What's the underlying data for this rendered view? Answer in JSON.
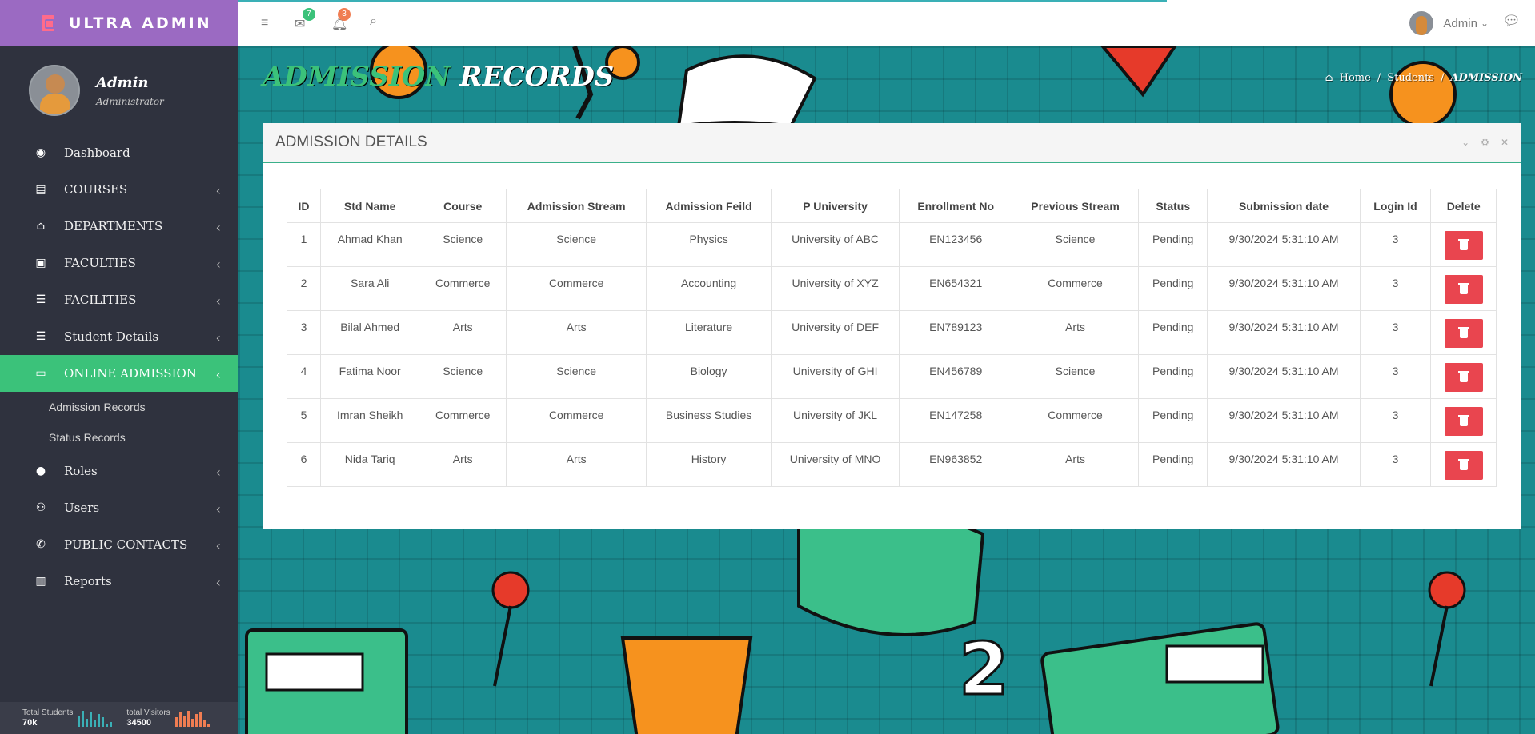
{
  "brand": {
    "title": "ULTRA ADMIN"
  },
  "profile": {
    "name": "Admin",
    "role": "Administrator"
  },
  "sidebar": {
    "items": [
      {
        "label": "Dashboard",
        "icon": "dashboard-icon",
        "has_submenu": false
      },
      {
        "label": "COURSES",
        "icon": "book-icon",
        "has_submenu": true
      },
      {
        "label": "DEPARTMENTS",
        "icon": "bank-icon",
        "has_submenu": true
      },
      {
        "label": "FACULTIES",
        "icon": "chalkboard-teacher-icon",
        "has_submenu": true
      },
      {
        "label": "FACILITIES",
        "icon": "list-icon",
        "has_submenu": true
      },
      {
        "label": "Student Details",
        "icon": "list-icon",
        "has_submenu": true
      },
      {
        "label": "ONLINE ADMISSION",
        "icon": "id-card-icon",
        "has_submenu": true,
        "active": true
      },
      {
        "label": "Roles",
        "icon": "user-circle-icon",
        "has_submenu": true
      },
      {
        "label": "Users",
        "icon": "users-icon",
        "has_submenu": true
      },
      {
        "label": "PUBLIC CONTACTS",
        "icon": "phone-icon",
        "has_submenu": true
      },
      {
        "label": "Reports",
        "icon": "bar-chart-icon",
        "has_submenu": true
      }
    ],
    "submenu": [
      "Admission Records",
      "Status Records"
    ]
  },
  "footer_stats": {
    "students_label": "Total Students",
    "students_value": "70k",
    "visitors_label": "total Visitors",
    "visitors_value": "34500"
  },
  "topbar": {
    "mail_badge": "7",
    "bell_badge": "3",
    "user_name": "Admin"
  },
  "page": {
    "title_part1": "ADMISSION",
    "title_part2": "RECORDS"
  },
  "breadcrumb": {
    "home": "Home",
    "students": "Students",
    "current": "ADMISSION",
    "sep": "/"
  },
  "panel": {
    "title": "ADMISSION DETAILS"
  },
  "table": {
    "headers": [
      "ID",
      "Std Name",
      "Course",
      "Admission Stream",
      "Admission Feild",
      "P University",
      "Enrollment No",
      "Previous Stream",
      "Status",
      "Submission date",
      "Login Id",
      "Delete"
    ],
    "rows": [
      [
        "1",
        "Ahmad Khan",
        "Science",
        "Science",
        "Physics",
        "University of ABC",
        "EN123456",
        "Science",
        "Pending",
        "9/30/2024 5:31:10 AM",
        "3"
      ],
      [
        "2",
        "Sara Ali",
        "Commerce",
        "Commerce",
        "Accounting",
        "University of XYZ",
        "EN654321",
        "Commerce",
        "Pending",
        "9/30/2024 5:31:10 AM",
        "3"
      ],
      [
        "3",
        "Bilal Ahmed",
        "Arts",
        "Arts",
        "Literature",
        "University of DEF",
        "EN789123",
        "Arts",
        "Pending",
        "9/30/2024 5:31:10 AM",
        "3"
      ],
      [
        "4",
        "Fatima Noor",
        "Science",
        "Science",
        "Biology",
        "University of GHI",
        "EN456789",
        "Science",
        "Pending",
        "9/30/2024 5:31:10 AM",
        "3"
      ],
      [
        "5",
        "Imran Sheikh",
        "Commerce",
        "Commerce",
        "Business Studies",
        "University of JKL",
        "EN147258",
        "Commerce",
        "Pending",
        "9/30/2024 5:31:10 AM",
        "3"
      ],
      [
        "6",
        "Nida Tariq",
        "Arts",
        "Arts",
        "History",
        "University of MNO",
        "EN963852",
        "Arts",
        "Pending",
        "9/30/2024 5:31:10 AM",
        "3"
      ]
    ]
  },
  "colors": {
    "brand": "#9b6ac2",
    "sidebar": "#2f323e",
    "active": "#3bc27a",
    "delete": "#e9454f",
    "background": "#1a8b8f"
  }
}
